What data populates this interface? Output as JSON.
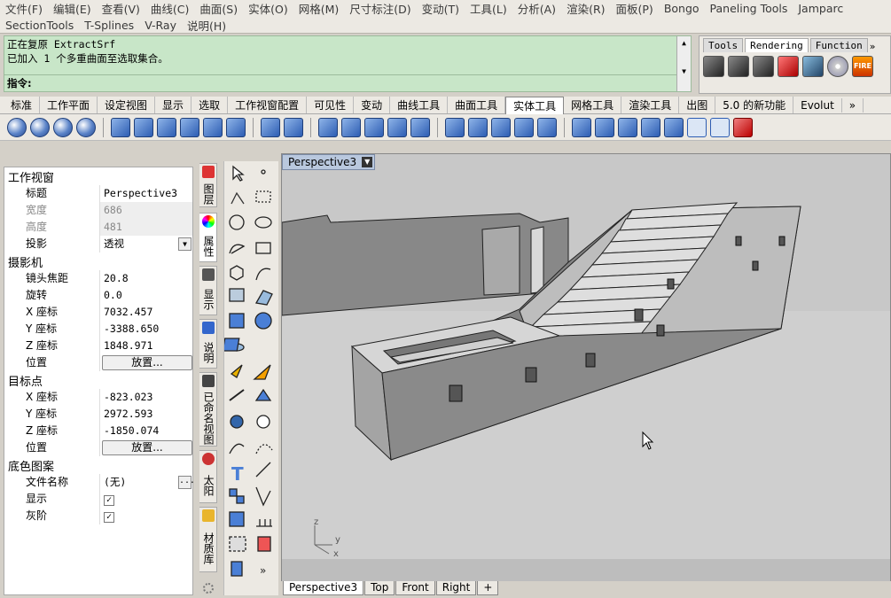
{
  "menu": {
    "row1": [
      "文件(F)",
      "编辑(E)",
      "查看(V)",
      "曲线(C)",
      "曲面(S)",
      "实体(O)",
      "网格(M)",
      "尺寸标注(D)",
      "变动(T)",
      "工具(L)",
      "分析(A)",
      "渲染(R)",
      "面板(P)",
      "Bongo",
      "Paneling Tools",
      "Jamparc"
    ],
    "row2": [
      "SectionTools",
      "T-Splines",
      "V-Ray",
      "说明(H)"
    ]
  },
  "command": {
    "history": [
      "正在复原 ExtractSrf",
      "已加入 1 个多重曲面至选取集合。"
    ],
    "prompt": "指令:"
  },
  "toolbar_panel": {
    "tabs": [
      "Tools",
      "Rendering",
      "Function"
    ],
    "active": "Rendering",
    "more": "»",
    "fire_label": "FIRE"
  },
  "main_tabs": {
    "items": [
      "标准",
      "工作平面",
      "设定视图",
      "显示",
      "选取",
      "工作视窗配置",
      "可见性",
      "变动",
      "曲线工具",
      "曲面工具",
      "实体工具",
      "网格工具",
      "渲染工具",
      "出图",
      "5.0 的新功能",
      "Evolut"
    ],
    "active_index": 10,
    "more": "»"
  },
  "properties": {
    "viewport_section": "工作视窗",
    "title_label": "标题",
    "title_value": "Perspective3",
    "width_label": "宽度",
    "width_value": "686",
    "height_label": "高度",
    "height_value": "481",
    "projection_label": "投影",
    "projection_value": "透视",
    "camera_section": "摄影机",
    "focal_label": "镜头焦距",
    "focal_value": "20.8",
    "rotation_label": "旋转",
    "rotation_value": "0.0",
    "cam_x_label": "X 座标",
    "cam_x_value": "7032.457",
    "cam_y_label": "Y 座标",
    "cam_y_value": "-3388.650",
    "cam_z_label": "Z 座标",
    "cam_z_value": "1848.971",
    "cam_pos_label": "位置",
    "cam_pos_button": "放置...",
    "target_section": "目标点",
    "tgt_x_label": "X 座标",
    "tgt_x_value": "-823.023",
    "tgt_y_label": "Y 座标",
    "tgt_y_value": "2972.593",
    "tgt_z_label": "Z 座标",
    "tgt_z_value": "-1850.074",
    "tgt_pos_label": "位置",
    "tgt_pos_button": "放置...",
    "wallpaper_section": "底色图案",
    "file_label": "文件名称",
    "file_value": "(无)",
    "file_button": "...",
    "show_label": "显示",
    "gray_label": "灰阶"
  },
  "side_tabs": [
    "图层",
    "属性",
    "显示",
    "说明",
    "已命名视图",
    "太阳",
    "材质库"
  ],
  "viewport": {
    "title": "Perspective3",
    "axis_x": "x",
    "axis_y": "y",
    "axis_z": "z"
  },
  "viewport_tabs": [
    "Perspective3",
    "Top",
    "Front",
    "Right",
    "+"
  ]
}
